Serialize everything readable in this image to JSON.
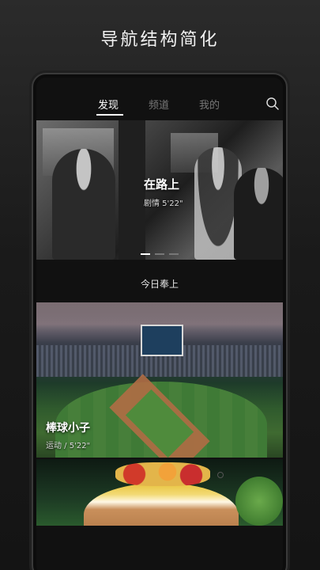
{
  "headline": "导航结构简化",
  "tabs": [
    {
      "label": "发现"
    },
    {
      "label": "频道"
    },
    {
      "label": "我的"
    }
  ],
  "icons": {
    "search": "search-icon"
  },
  "hero": {
    "title": "在路上",
    "meta": "剧情  5'22\"",
    "pages": 3,
    "active_page": 1
  },
  "section": {
    "label": "今日奉上"
  },
  "cards": [
    {
      "title": "棒球小子",
      "meta": "运动 / 5'22\""
    }
  ],
  "colors": {
    "background": "#1a1a1a",
    "active_tab": "#ffffff",
    "inactive_tab": "#777777"
  }
}
